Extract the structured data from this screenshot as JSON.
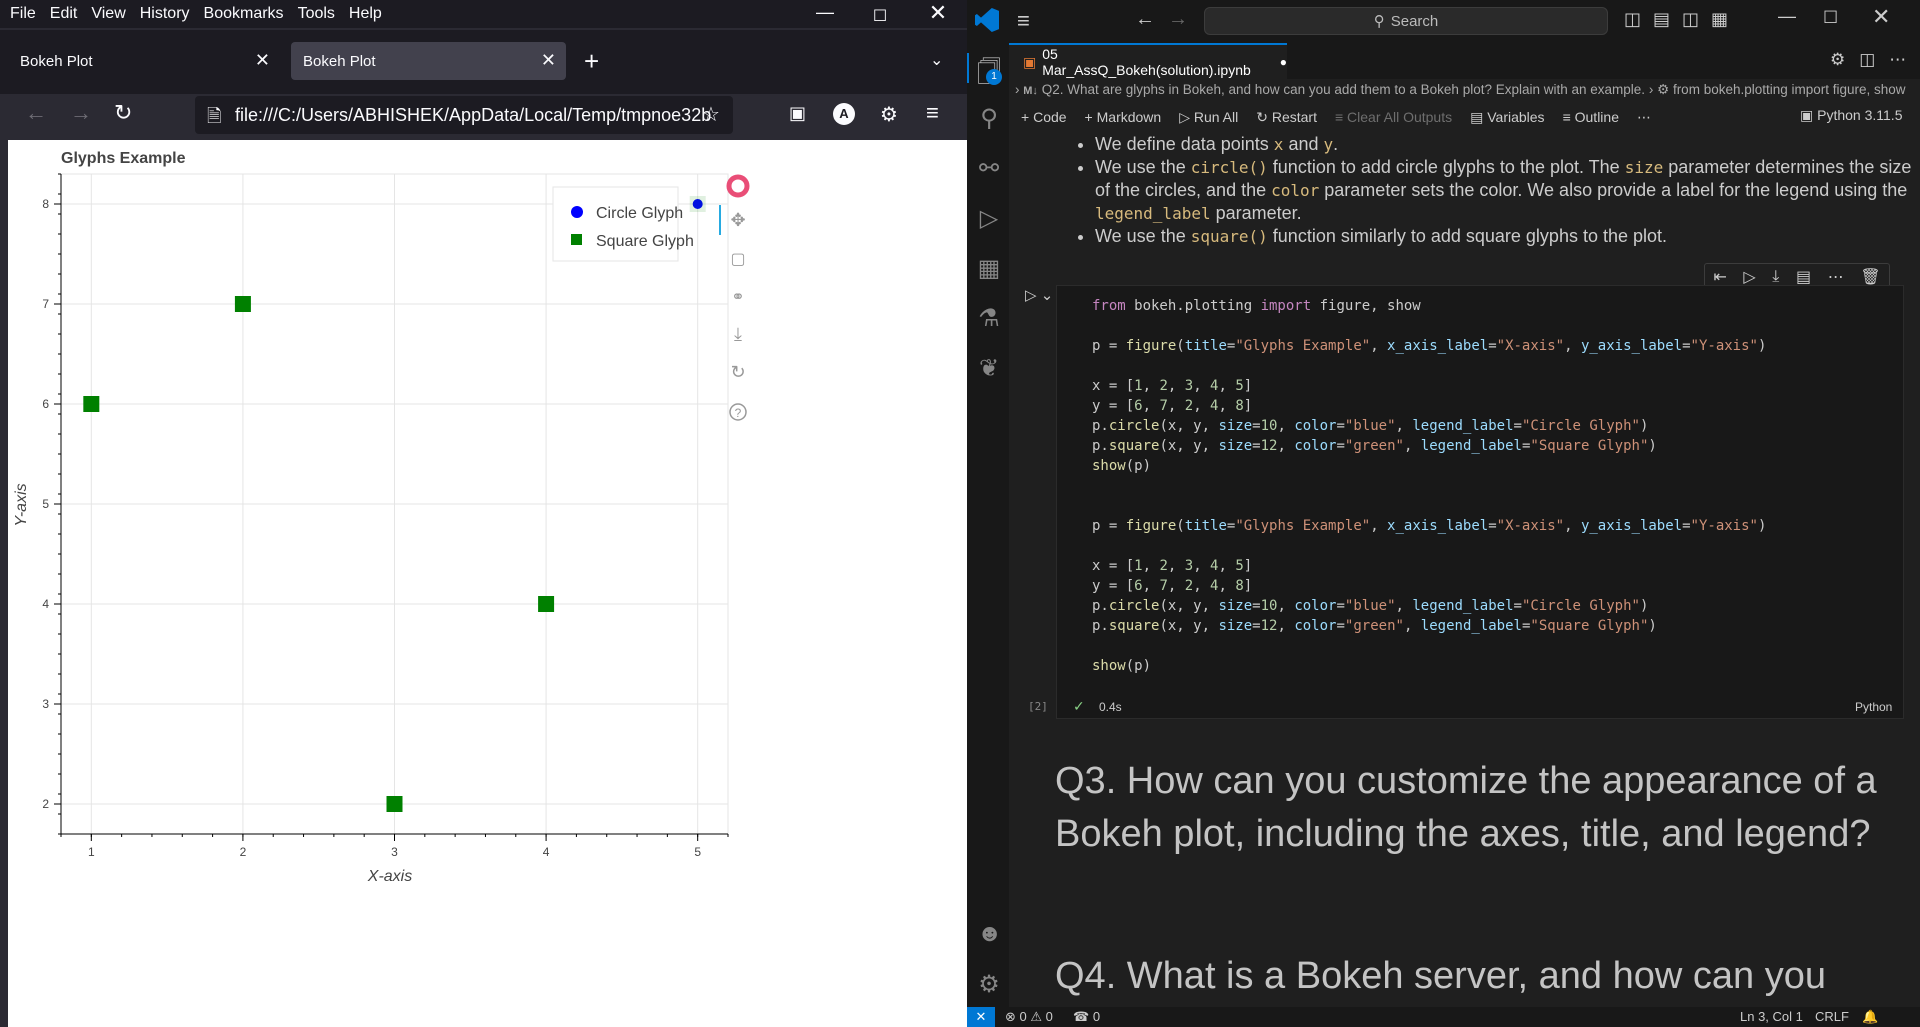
{
  "firefox": {
    "menu": [
      "File",
      "Edit",
      "View",
      "History",
      "Bookmarks",
      "Tools",
      "Help"
    ],
    "tabs": [
      {
        "label": "Bokeh Plot"
      },
      {
        "label": "Bokeh Plot"
      }
    ],
    "url": "file:///C:/Users/ABHISHEK/AppData/Local/Temp/tmpnoe32b",
    "account_initial": "A"
  },
  "chart_data": {
    "type": "scatter",
    "title": "Glyphs Example",
    "xlabel": "X-axis",
    "ylabel": "Y-axis",
    "xlim": [
      0.8,
      5.2
    ],
    "ylim": [
      1.7,
      8.3
    ],
    "x_ticks": [
      1,
      2,
      3,
      4,
      5
    ],
    "y_ticks": [
      2,
      3,
      4,
      5,
      6,
      7,
      8
    ],
    "grid": true,
    "legend_position": "top-right",
    "series": [
      {
        "name": "Circle Glyph",
        "marker": "circle",
        "color": "#0000ff",
        "x": [
          1,
          2,
          3,
          4,
          5
        ],
        "y": [
          6,
          7,
          2,
          4,
          8
        ]
      },
      {
        "name": "Square Glyph",
        "marker": "square",
        "color": "#008000",
        "x": [
          1,
          2,
          3,
          4,
          5
        ],
        "y": [
          6,
          7,
          2,
          4,
          8
        ]
      }
    ]
  },
  "vscode": {
    "search": "Search",
    "tab_title": "05 Mar_AssQ_Bokeh(solution).ipynb",
    "breadcrumb": "Q2. What are glyphs in Bokeh, and how can you add them to a Bokeh plot? Explain with an example.",
    "breadcrumb_cell": "from bokeh.plotting import figure, show",
    "toolbar": {
      "code": "Code",
      "markdown": "Markdown",
      "run_all": "Run All",
      "restart": "Restart",
      "clear": "Clear All Outputs",
      "variables": "Variables",
      "outline": "Outline",
      "kernel": "Python 3.11.5"
    },
    "md_bullets": [
      [
        "We define data points ",
        "x",
        " and ",
        "y",
        "."
      ],
      [
        "We use the ",
        "circle()",
        " function to add circle glyphs to the plot. The ",
        "size",
        " parameter determines the size of the circles, and the ",
        "color",
        " parameter sets the color. We also provide a label for the legend using the ",
        "legend_label",
        " parameter."
      ],
      [
        "We use the ",
        "square()",
        " function similarly to add square glyphs to the plot."
      ]
    ],
    "cell_exec": "[2]",
    "cell_time": "0.4s",
    "cell_lang": "Python",
    "q3": "Q3. How can you customize the appearance of a Bokeh plot, including the axes, title, and legend?",
    "q4": "Q4. What is a Bokeh server, and how can you",
    "status": {
      "errors": "0",
      "warnings": "0",
      "ports": "0",
      "position": "Ln 3, Col 1",
      "eol": "CRLF"
    },
    "badge": "1"
  }
}
